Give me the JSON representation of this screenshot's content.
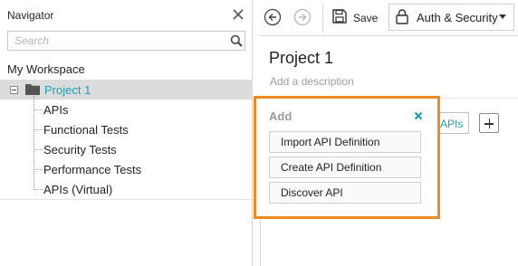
{
  "navigator": {
    "title": "Navigator",
    "search_placeholder": "Search",
    "workspace_label": "My Workspace",
    "project": {
      "label": "Project 1",
      "children": [
        "APIs",
        "Functional Tests",
        "Security Tests",
        "Performance Tests",
        "APIs (Virtual)"
      ]
    }
  },
  "toolbar": {
    "save_label": "Save",
    "auth_label": "Auth & Security"
  },
  "main": {
    "project_title": "Project 1",
    "description_placeholder": "Add a description",
    "apis_chip_label": "APIs"
  },
  "add_popup": {
    "title": "Add",
    "options": [
      "Import API Definition",
      "Create API Definition",
      "Discover API"
    ]
  },
  "colors": {
    "accent": "#1da0b8",
    "highlight_border": "#f08a24",
    "selection_bg": "#dcdcdc"
  },
  "icons": [
    "close-icon",
    "search-icon",
    "folder-icon",
    "back-arrow-icon",
    "forward-arrow-icon",
    "save-icon",
    "lock-icon",
    "chevron-down-icon",
    "plus-icon"
  ]
}
